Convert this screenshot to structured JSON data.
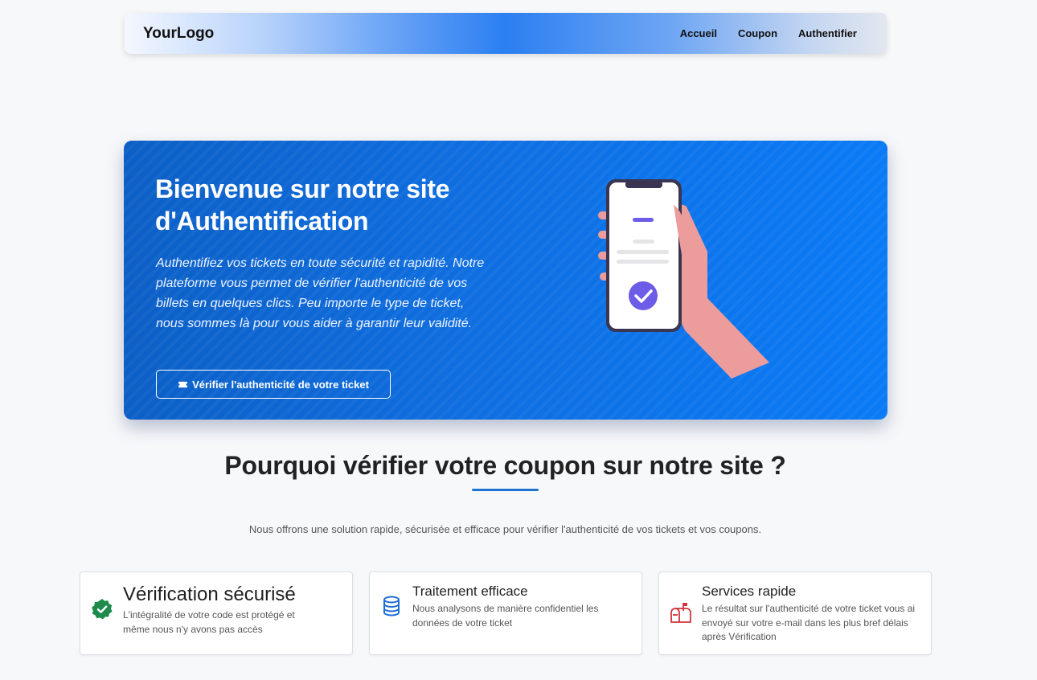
{
  "navbar": {
    "logo": "YourLogo",
    "links": [
      "Accueil",
      "Coupon",
      "Authentifier"
    ]
  },
  "hero": {
    "title": "Bienvenue sur notre site d'Authentification",
    "text": "Authentifiez vos tickets en toute sécurité et rapidité. Notre plateforme vous permet de vérifier l'authenticité de vos billets en quelques clics. Peu importe le type de ticket, nous sommes là pour vous aider à garantir leur validité.",
    "button_label": "Vérifier l'authenticité de votre ticket",
    "button_icon": "ticket-icon",
    "illustration": "hand-holding-phone-with-check"
  },
  "section": {
    "title": "Pourquoi vérifier votre coupon sur notre site ?",
    "subtitle": "Nous offrons une solution rapide, sécurisée et efficace pour vérifier l'authenticité de vos tickets et vos coupons."
  },
  "features": [
    {
      "icon": "check-badge-icon",
      "title": "Vérification sécurisé",
      "description": "L'intégralité de votre code est protégé et même nous n'y avons pas accès"
    },
    {
      "icon": "database-icon",
      "title": "Traitement efficace",
      "description": "Nous analysons de manière confidentiel les données de votre ticket"
    },
    {
      "icon": "mailbox-icon",
      "title": "Services rapide",
      "description": "Le résultat sur l'authenticité de votre ticket vous ai envoyé sur votre e-mail dans les plus bref délais après Vérification"
    }
  ],
  "colors": {
    "primary": "#0a6fe4",
    "accent_underline": "#1c74cf",
    "check_green": "#1e8a4c",
    "database_blue": "#1f6fd6",
    "mailbox_red": "#d0333a",
    "phone_check_purple": "#6c5ce7",
    "hand_skin": "#ec9c9a"
  }
}
